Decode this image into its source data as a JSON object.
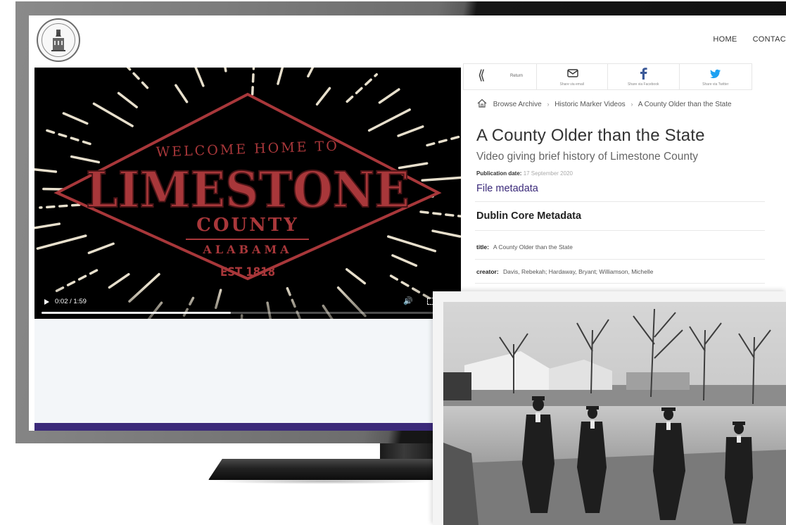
{
  "nav": {
    "home": "HOME",
    "contact": "CONTAC"
  },
  "video": {
    "time": "0:02 / 1:59",
    "progress": 0.48,
    "title_card": {
      "line1": "WELCOME HOME TO",
      "line2": "LIMESTONE",
      "line3": "COUNTY",
      "line4": "ALABAMA",
      "line5": "EST 1818"
    }
  },
  "share": {
    "return": "Return",
    "email": "Share via email",
    "facebook": "Share via Facebook",
    "twitter": "Share via Twitter"
  },
  "breadcrumb": {
    "items": [
      "Browse Archive",
      "Historic Marker Videos",
      "A County Older than the State"
    ]
  },
  "item": {
    "title": "A County Older than the State",
    "subtitle": "Video giving brief history of Limestone County",
    "publication_label": "Publication date:",
    "publication_value": "17 September 2020",
    "file_metadata": "File metadata",
    "section_title": "Dublin Core Metadata",
    "fields": [
      {
        "label": "title:",
        "value": "A County Older than the State"
      },
      {
        "label": "creator:",
        "value": "Davis, Rebekah; Hardaway, Bryant; Williamson, Michelle"
      }
    ]
  },
  "colors": {
    "accent_purple": "#3b2a7a",
    "title_red": "#a8373a",
    "twitter_blue": "#1da1f2",
    "facebook_blue": "#3b5998"
  },
  "icons": [
    "chevron-left-icon",
    "email-icon",
    "facebook-icon",
    "twitter-icon",
    "home-icon",
    "play-icon",
    "volume-icon",
    "fullscreen-icon"
  ]
}
